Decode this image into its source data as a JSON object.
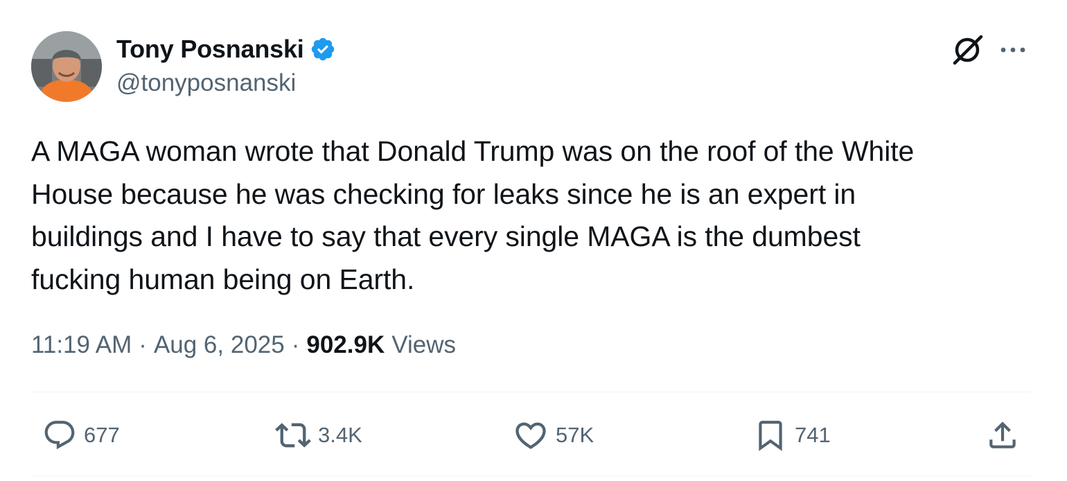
{
  "author": {
    "display_name": "Tony Posnanski",
    "handle": "@tonyposnanski",
    "verified": true
  },
  "tweet": {
    "text_lines": [
      "A MAGA woman wrote that Donald Trump was on the roof of the White",
      "House because he was checking for leaks since he is an expert in",
      "buildings and I have to say that every single MAGA is the dumbest",
      "fucking human being on Earth."
    ]
  },
  "meta": {
    "time": "11:19 AM",
    "separator": "·",
    "date": "Aug 6, 2025",
    "views_count": "902.9K",
    "views_label": "Views"
  },
  "actions": {
    "replies": "677",
    "reposts": "3.4K",
    "likes": "57K",
    "bookmarks": "741"
  },
  "icons": {
    "verified": "verified-badge-icon",
    "grok": "grok-icon",
    "more": "more-icon",
    "reply": "reply-icon",
    "repost": "repost-icon",
    "like": "heart-icon",
    "bookmark": "bookmark-icon",
    "share": "share-icon"
  },
  "colors": {
    "text_primary": "#0f1419",
    "text_secondary": "#536471",
    "verified_blue": "#1d9bf0",
    "divider": "#eff3f4"
  }
}
